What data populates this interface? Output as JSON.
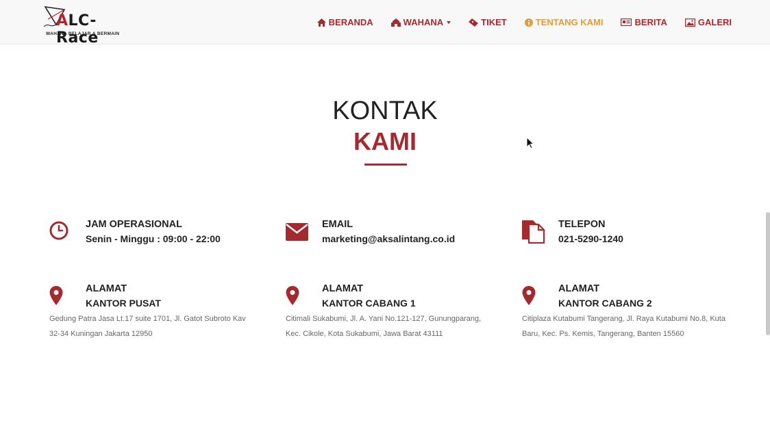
{
  "logo": {
    "brand_first": "A",
    "brand_rest": "LC-Race",
    "tagline": "WAHANA BELAJAR & BERMAIN"
  },
  "nav": [
    {
      "label": "BERANDA",
      "icon": "home-icon"
    },
    {
      "label": "WAHANA",
      "icon": "amusement-park-icon",
      "dropdown": true
    },
    {
      "label": "TIKET",
      "icon": "ticket-icon"
    },
    {
      "label": "TENTANG KAMI",
      "icon": "info-icon",
      "active": true
    },
    {
      "label": "BERITA",
      "icon": "newspaper-icon"
    },
    {
      "label": "GALERI",
      "icon": "image-icon"
    }
  ],
  "section": {
    "title_line1": "KONTAK",
    "title_line2": "KAMI"
  },
  "contacts": {
    "hours": {
      "label": "JAM OPERASIONAL",
      "value": "Senin - Minggu : 09:00 - 22:00",
      "icon": "clock-icon"
    },
    "email": {
      "label": "EMAIL",
      "value": "marketing@aksalintang.co.id",
      "icon": "envelope-icon"
    },
    "phone": {
      "label": "TELEPON",
      "value": "021-5290-1240",
      "icon": "phone-document-icon"
    }
  },
  "addresses": [
    {
      "label": "ALAMAT",
      "office": "KANTOR PUSAT",
      "address": "Gedung Patra Jasa Lt.17 suite 1701, Jl. Gatot Subroto Kav 32-34 Kuningan Jakarta 12950",
      "icon": "map-pin-icon"
    },
    {
      "label": "ALAMAT",
      "office": "KANTOR CABANG 1",
      "address": "Citimali Sukabumi, Jl. A. Yani No.121-127, Gunungparang, Kec. Cikole, Kota Sukabumi, Jawa Barat 43111",
      "icon": "map-pin-icon"
    },
    {
      "label": "ALAMAT",
      "office": "KANTOR CABANG 2",
      "address": "Citiplaza Kutabumi Tangerang, Jl. Raya Kutabumi No.8, Kuta Baru, Kec. Ps. Kemis, Tangerang, Banten 15560",
      "icon": "map-pin-icon"
    }
  ],
  "colors": {
    "primary": "#a52a2f",
    "active_nav": "#e39b3c",
    "navbar_bg": "#f8f8f8"
  }
}
